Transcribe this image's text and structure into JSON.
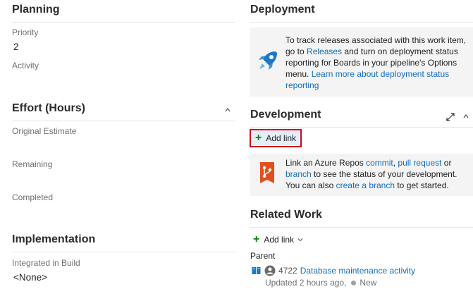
{
  "planning": {
    "title": "Planning",
    "priority_label": "Priority",
    "priority_value": "2",
    "activity_label": "Activity"
  },
  "effort": {
    "title": "Effort (Hours)",
    "original_estimate_label": "Original Estimate",
    "remaining_label": "Remaining",
    "completed_label": "Completed"
  },
  "implementation": {
    "title": "Implementation",
    "integrated_in_build_label": "Integrated in Build",
    "integrated_in_build_value": "<None>"
  },
  "deployment": {
    "title": "Deployment",
    "text_1": "To track releases associated with this work item, go to ",
    "link_releases": "Releases",
    "text_2": " and turn on deployment status reporting for Boards in your pipeline's Options menu. ",
    "link_learn_more": "Learn more about deployment status reporting"
  },
  "development": {
    "title": "Development",
    "add_link_label": "Add link",
    "text_1": "Link an Azure Repos ",
    "link_commit": "commit",
    "sep": ", ",
    "link_pull_request": "pull request",
    "text_2": " or ",
    "link_branch": "branch",
    "text_3": " to see the status of your development. You can also ",
    "link_create_branch": "create a branch",
    "text_4": " to get started."
  },
  "related_work": {
    "title": "Related Work",
    "add_link_label": "Add link",
    "group_label": "Parent",
    "item_id": "4722",
    "item_title": "Database maintenance activity",
    "item_updated": "Updated 2 hours ago,",
    "item_state": "New"
  },
  "colors": {
    "accent": "#106ebe",
    "add_green": "#107c10",
    "highlight_border": "#d0021b",
    "info_bg": "#f4f4f4",
    "state_dot": "#a0a0a0"
  }
}
